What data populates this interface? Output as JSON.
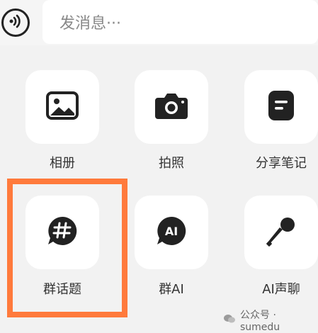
{
  "composer": {
    "placeholder": "发消息···"
  },
  "actions": [
    {
      "label": "相册"
    },
    {
      "label": "拍照"
    },
    {
      "label": "分享笔记"
    },
    {
      "label": "群话题"
    },
    {
      "label": "群AI"
    },
    {
      "label": "AI声聊"
    }
  ],
  "badges": {
    "group_ai_text": "AI"
  },
  "watermark": {
    "text": "公众号 · sumedu"
  },
  "colors": {
    "highlight": "#ff7a3c"
  }
}
